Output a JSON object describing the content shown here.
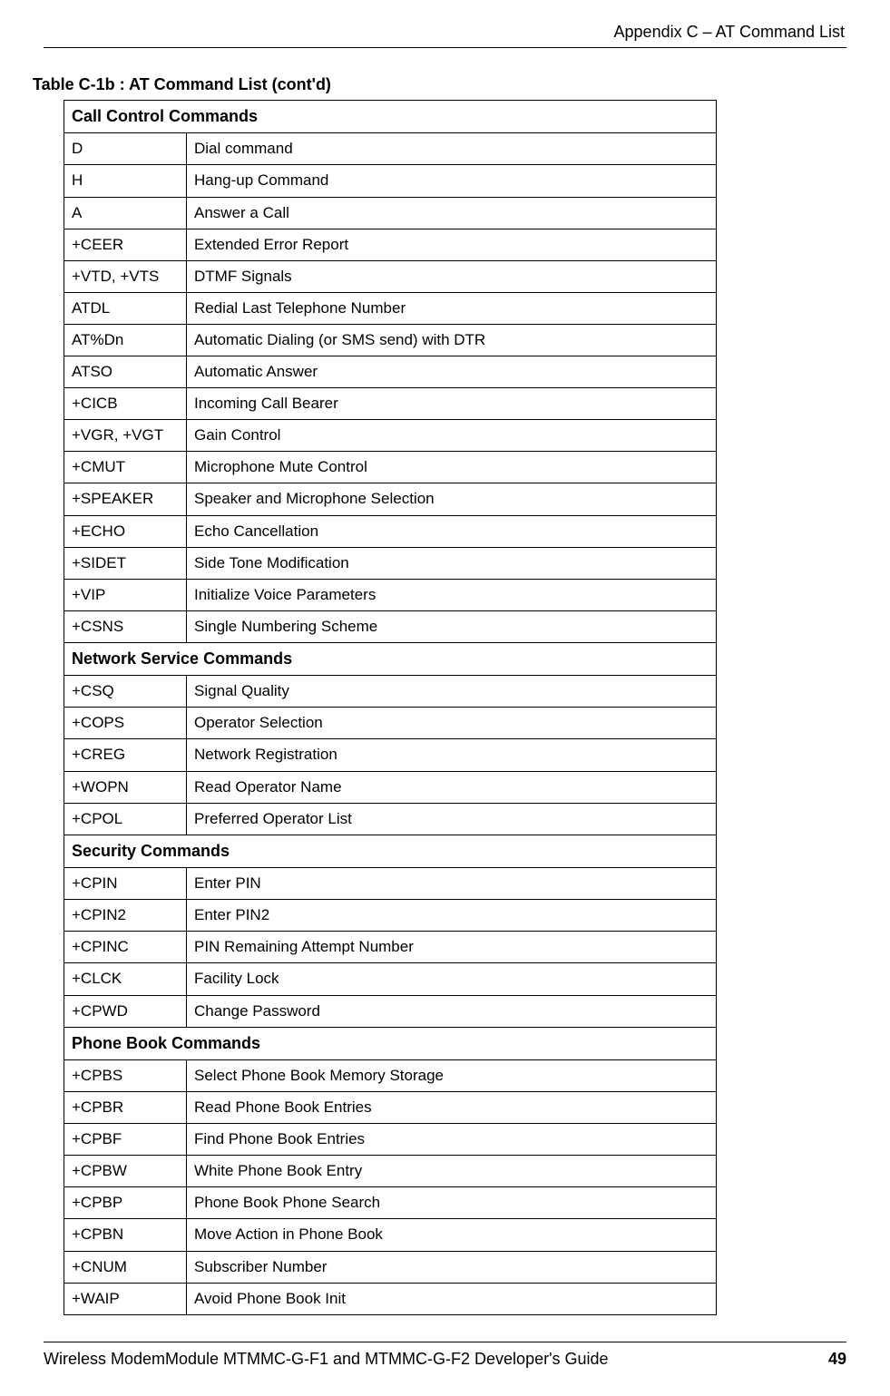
{
  "header": {
    "appendix": "Appendix C – AT Command List"
  },
  "table": {
    "title": "Table C-1b : AT Command List (cont'd)",
    "sections": [
      {
        "heading": "Call Control Commands",
        "rows": [
          {
            "cmd": "D",
            "desc": "Dial command"
          },
          {
            "cmd": "H",
            "desc": "Hang-up Command"
          },
          {
            "cmd": "A",
            "desc": "Answer a Call"
          },
          {
            "cmd": "+CEER",
            "desc": "Extended Error Report"
          },
          {
            "cmd": "+VTD, +VTS",
            "desc": "DTMF Signals"
          },
          {
            "cmd": "ATDL",
            "desc": "Redial Last Telephone Number"
          },
          {
            "cmd": "AT%Dn",
            "desc": "Automatic Dialing (or SMS send) with DTR"
          },
          {
            "cmd": "ATSO",
            "desc": "Automatic Answer"
          },
          {
            "cmd": "+CICB",
            "desc": "Incoming Call Bearer"
          },
          {
            "cmd": "+VGR, +VGT",
            "desc": "Gain Control"
          },
          {
            "cmd": "+CMUT",
            "desc": "Microphone Mute Control"
          },
          {
            "cmd": "+SPEAKER",
            "desc": "Speaker and Microphone Selection"
          },
          {
            "cmd": "+ECHO",
            "desc": "Echo Cancellation"
          },
          {
            "cmd": "+SIDET",
            "desc": "Side Tone Modification"
          },
          {
            "cmd": "+VIP",
            "desc": "Initialize Voice Parameters"
          },
          {
            "cmd": "+CSNS",
            "desc": "Single Numbering Scheme"
          }
        ]
      },
      {
        "heading": "Network Service Commands",
        "rows": [
          {
            "cmd": "+CSQ",
            "desc": "Signal Quality"
          },
          {
            "cmd": "+COPS",
            "desc": "Operator Selection"
          },
          {
            "cmd": "+CREG",
            "desc": "Network Registration"
          },
          {
            "cmd": "+WOPN",
            "desc": "Read Operator Name"
          },
          {
            "cmd": "+CPOL",
            "desc": "Preferred Operator List"
          }
        ]
      },
      {
        "heading": "Security Commands",
        "rows": [
          {
            "cmd": "+CPIN",
            "desc": "Enter PIN"
          },
          {
            "cmd": "+CPIN2",
            "desc": "Enter PIN2"
          },
          {
            "cmd": "+CPINC",
            "desc": "PIN Remaining Attempt Number"
          },
          {
            "cmd": "+CLCK",
            "desc": "Facility Lock"
          },
          {
            "cmd": "+CPWD",
            "desc": "Change Password"
          }
        ]
      },
      {
        "heading": "Phone Book Commands",
        "rows": [
          {
            "cmd": "+CPBS",
            "desc": "Select Phone Book Memory Storage"
          },
          {
            "cmd": "+CPBR",
            "desc": "Read Phone Book Entries"
          },
          {
            "cmd": "+CPBF",
            "desc": "Find Phone Book Entries"
          },
          {
            "cmd": "+CPBW",
            "desc": "White Phone Book Entry"
          },
          {
            "cmd": "+CPBP",
            "desc": "Phone Book Phone Search"
          },
          {
            "cmd": "+CPBN",
            "desc": "Move Action in Phone Book"
          },
          {
            "cmd": "+CNUM",
            "desc": "Subscriber Number"
          },
          {
            "cmd": "+WAIP",
            "desc": "Avoid Phone Book Init"
          }
        ]
      }
    ]
  },
  "footer": {
    "text": "Wireless ModemModule MTMMC-G-F1 and MTMMC-G-F2 Developer's Guide",
    "page": "49"
  }
}
